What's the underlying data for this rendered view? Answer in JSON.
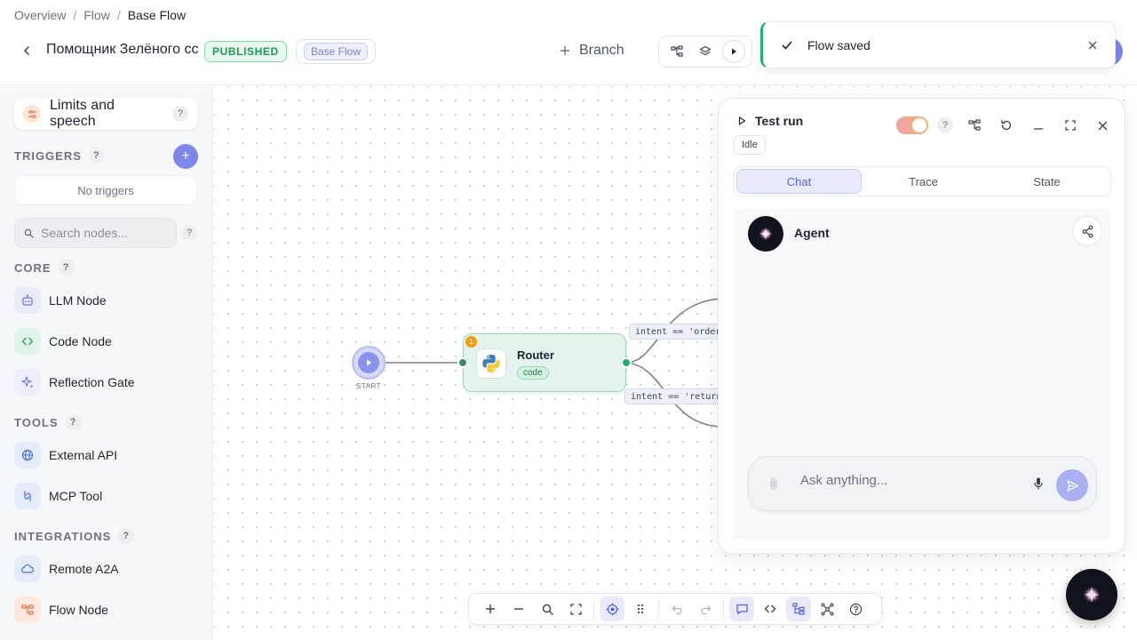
{
  "breadcrumb": {
    "items": [
      "Overview",
      "Flow"
    ],
    "current": "Base Flow",
    "separator": "/"
  },
  "header": {
    "flow_title": "Помощник Зелёного сс",
    "status_badge": "PUBLISHED",
    "version_badge": "Base Flow",
    "branch_label": "Branch",
    "accent_color": "#7d87ea"
  },
  "toast": {
    "message": "Flow saved",
    "status_color": "#1fb26b"
  },
  "sidebar": {
    "limits_label": "Limits and speech",
    "help_glyph": "?",
    "triggers_title": "TRIGGERS",
    "add_glyph": "+",
    "no_triggers": "No triggers",
    "search_placeholder": "Search nodes...",
    "sections": {
      "core": "CORE",
      "tools": "TOOLS",
      "integrations": "INTEGRATIONS"
    },
    "core_items": [
      {
        "label": "LLM Node",
        "icon": "robot-icon"
      },
      {
        "label": "Code Node",
        "icon": "code-icon"
      },
      {
        "label": "Reflection Gate",
        "icon": "sparkle-icon"
      }
    ],
    "tool_items": [
      {
        "label": "External API",
        "icon": "globe-icon"
      },
      {
        "label": "MCP Tool",
        "icon": "mcp-icon"
      }
    ],
    "integration_items": [
      {
        "label": "Remote A2A",
        "icon": "cloud-icon"
      },
      {
        "label": "Flow Node",
        "icon": "flow-icon"
      }
    ]
  },
  "canvas": {
    "start_label": "START",
    "router": {
      "title": "Router",
      "tag": "code",
      "badge": "1",
      "icon": "python-icon"
    },
    "edge_labels": [
      "intent == 'order'",
      "intent == 'returns"
    ]
  },
  "test_panel": {
    "title": "Test run",
    "status": "Idle",
    "help_glyph": "?",
    "tabs": [
      "Chat",
      "Trace",
      "State"
    ],
    "active_tab": "Chat",
    "agent_name": "Agent",
    "input_placeholder": "Ask anything..."
  }
}
